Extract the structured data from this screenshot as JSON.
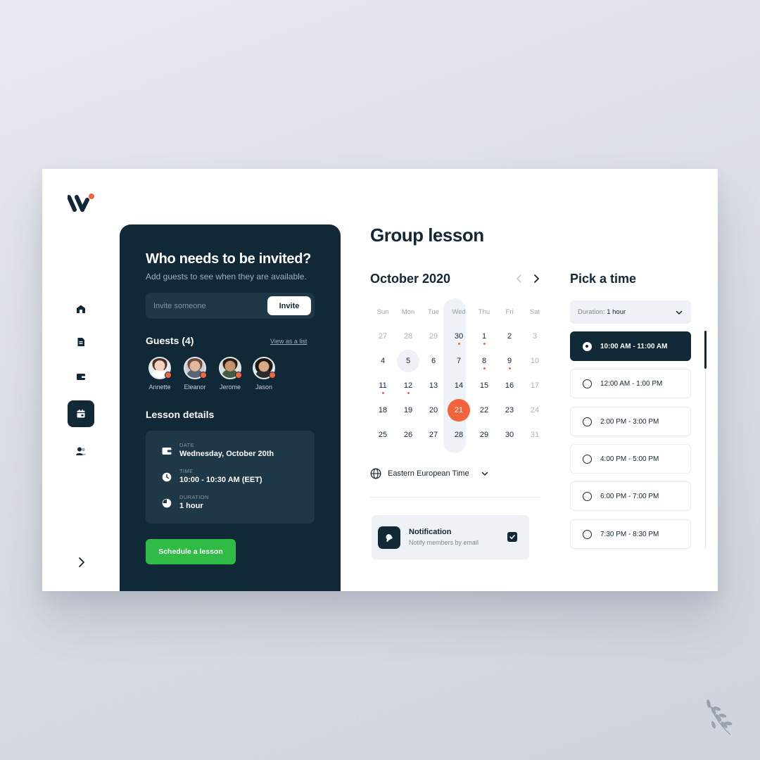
{
  "sidebar": {
    "items": [
      {
        "icon": "home-icon",
        "active": false
      },
      {
        "icon": "document-icon",
        "active": false
      },
      {
        "icon": "wallet-icon",
        "active": false
      },
      {
        "icon": "calendar-icon",
        "active": true
      },
      {
        "icon": "users-icon",
        "active": false
      }
    ],
    "expand_icon": "chevron-right-icon"
  },
  "invite_panel": {
    "title": "Who needs to be invited?",
    "subtitle": "Add guests to see when they are available.",
    "invite_placeholder": "Invite someone",
    "invite_button": "Invite",
    "guests_title": "Guests (4)",
    "view_list_link": "View as a list",
    "guests": [
      {
        "name": "Annette"
      },
      {
        "name": "Eleanor"
      },
      {
        "name": "Jerome"
      },
      {
        "name": "Jason"
      }
    ],
    "details_title": "Lesson details",
    "details": {
      "date_label": "DATE",
      "date_value": "Wednesday, October 20th",
      "time_label": "TIME",
      "time_value": "10:00 - 10:30 AM (EET)",
      "duration_label": "DURATION",
      "duration_value": "1 hour"
    },
    "schedule_button": "Schedule a lesson"
  },
  "main": {
    "title": "Group lesson",
    "calendar": {
      "month_label": "October  2020",
      "weekdays": [
        "Sun",
        "Mon",
        "Tue",
        "Wed",
        "Thu",
        "Fri",
        "Sat"
      ],
      "weeks": [
        [
          {
            "d": "27",
            "muted": true
          },
          {
            "d": "28",
            "muted": true
          },
          {
            "d": "29",
            "muted": true
          },
          {
            "d": "30",
            "dot": true
          },
          {
            "d": "1",
            "dot": true
          },
          {
            "d": "2"
          },
          {
            "d": "3",
            "muted": true
          }
        ],
        [
          {
            "d": "4"
          },
          {
            "d": "5",
            "hl": true
          },
          {
            "d": "6"
          },
          {
            "d": "7"
          },
          {
            "d": "8",
            "dot": true
          },
          {
            "d": "9",
            "dot": true
          },
          {
            "d": "10",
            "muted": true
          }
        ],
        [
          {
            "d": "11",
            "dot": true
          },
          {
            "d": "12",
            "dot": true
          },
          {
            "d": "13"
          },
          {
            "d": "14"
          },
          {
            "d": "15"
          },
          {
            "d": "16"
          },
          {
            "d": "17",
            "muted": true
          }
        ],
        [
          {
            "d": "18"
          },
          {
            "d": "19"
          },
          {
            "d": "20"
          },
          {
            "d": "21",
            "selected": true
          },
          {
            "d": "22"
          },
          {
            "d": "23"
          },
          {
            "d": "24",
            "muted": true
          }
        ],
        [
          {
            "d": "25"
          },
          {
            "d": "26"
          },
          {
            "d": "27"
          },
          {
            "d": "28"
          },
          {
            "d": "29"
          },
          {
            "d": "30"
          },
          {
            "d": "31",
            "muted": true
          }
        ]
      ]
    },
    "timezone": "Eastern European Time",
    "notification": {
      "title": "Notification",
      "subtitle": "Notify members by email",
      "checked": true
    }
  },
  "time_picker": {
    "title": "Pick a time",
    "duration_label": "Duration:",
    "duration_value": "1 hour",
    "slots": [
      {
        "label": "10:00 AM - 11:00 AM",
        "selected": true
      },
      {
        "label": "12:00 AM - 1:00 PM",
        "selected": false
      },
      {
        "label": "2:00 PM - 3:00 PM",
        "selected": false
      },
      {
        "label": "4:00 PM - 5:00 PM",
        "selected": false
      },
      {
        "label": "6:00 PM - 7:00 PM",
        "selected": false
      },
      {
        "label": "7:30 PM - 8:30 PM",
        "selected": false
      }
    ]
  },
  "colors": {
    "navy": "#112837",
    "accent_orange": "#f1643d",
    "green": "#2fbb45",
    "light_panel": "#eef1f5"
  }
}
